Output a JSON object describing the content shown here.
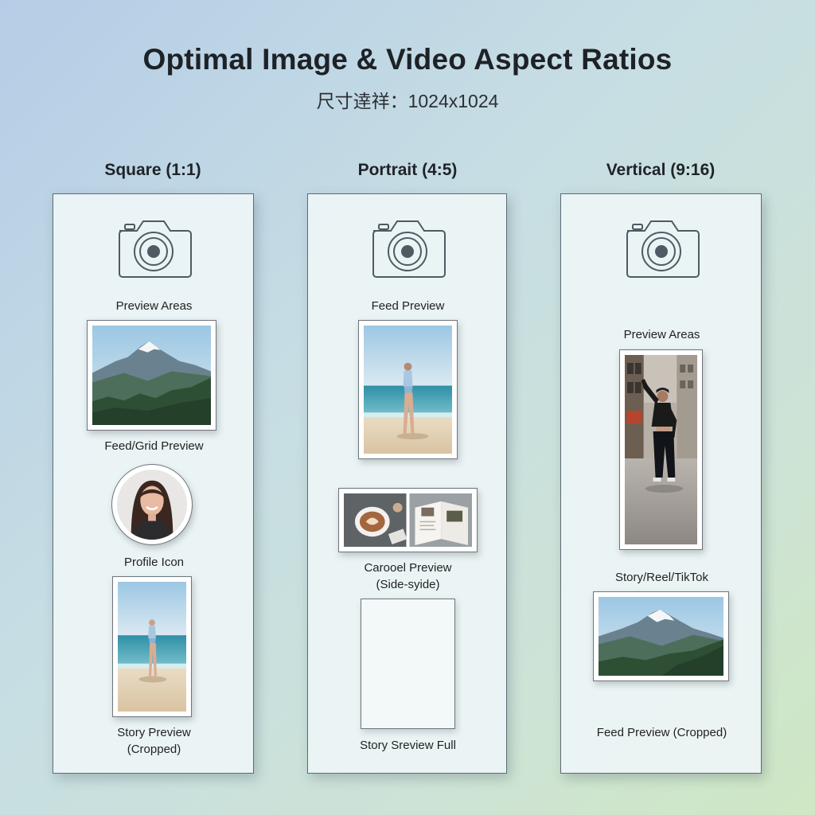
{
  "header": {
    "title": "Optimal Image & Video Aspect Ratios",
    "subtitle": "尺寸逹祥：1024x1024"
  },
  "columns": [
    {
      "title": "Square (1:1)",
      "labels": [
        "Preview Areas",
        "Feed/Grid Preview",
        "Profile Icon",
        "Story Preview",
        "(Cropped)"
      ]
    },
    {
      "title": "Portrait (4:5)",
      "labels": [
        "Feed Preview",
        "Carooel Preview",
        "(Side-syide)",
        "Story Sreview Full"
      ]
    },
    {
      "title": "Vertical (9:16)",
      "labels": [
        "Preview Areas",
        "Story/Reel/TikTok",
        "Feed Preview (Cropped)"
      ]
    }
  ],
  "icons": [
    "camera-icon"
  ],
  "colors": {
    "panel_border": "#5e6b75",
    "icon_stroke": "#4f5a63",
    "sky": "#a9cde6",
    "sea": "#3fa3b6",
    "sand": "#e2cfb2"
  }
}
